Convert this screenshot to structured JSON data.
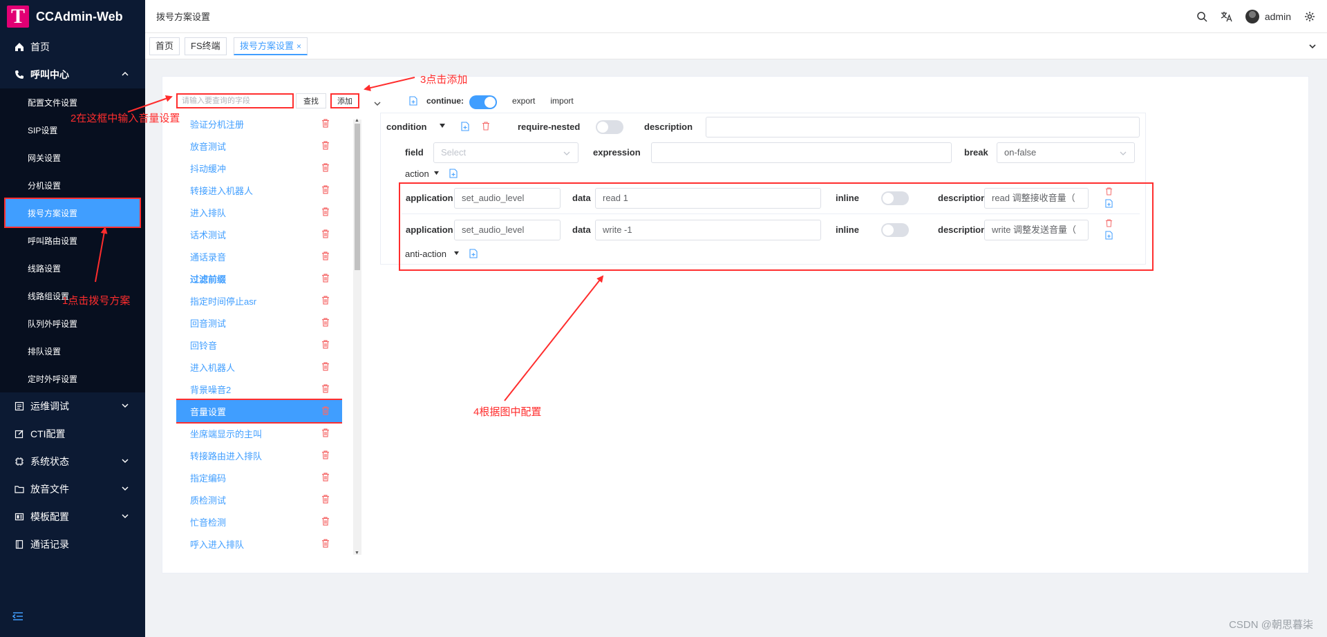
{
  "app": {
    "title": "CCAdmin-Web",
    "logo_letter": "T"
  },
  "sidebar": {
    "items": [
      {
        "label": "首页",
        "icon": "home-icon"
      },
      {
        "label": "呼叫中心",
        "icon": "phone-icon",
        "expanded": true,
        "children": [
          {
            "label": "配置文件设置"
          },
          {
            "label": "SIP设置"
          },
          {
            "label": "网关设置"
          },
          {
            "label": "分机设置"
          },
          {
            "label": "拨号方案设置",
            "active": true
          },
          {
            "label": "呼叫路由设置"
          },
          {
            "label": "线路设置"
          },
          {
            "label": "线路组设置"
          },
          {
            "label": "队列外呼设置"
          },
          {
            "label": "排队设置"
          },
          {
            "label": "定时外呼设置"
          }
        ]
      },
      {
        "label": "运维调试",
        "icon": "debug-icon"
      },
      {
        "label": "CTI配置",
        "icon": "edit-icon"
      },
      {
        "label": "系统状态",
        "icon": "chip-icon"
      },
      {
        "label": "放音文件",
        "icon": "folder-icon"
      },
      {
        "label": "模板配置",
        "icon": "template-icon"
      },
      {
        "label": "通话记录",
        "icon": "notebook-icon"
      }
    ]
  },
  "header": {
    "breadcrumb": "拨号方案设置",
    "username": "admin"
  },
  "tabs": [
    {
      "label": "首页"
    },
    {
      "label": "FS终端"
    },
    {
      "label": "拨号方案设置",
      "active": true,
      "close": "×"
    }
  ],
  "list_panel": {
    "search_placeholder": "请输入要查询的字段",
    "search_button": "查找",
    "add_button": "添加",
    "items": [
      {
        "label": "验证分机注册"
      },
      {
        "label": "放音测试"
      },
      {
        "label": "抖动缓冲"
      },
      {
        "label": "转接进入机器人"
      },
      {
        "label": "进入排队"
      },
      {
        "label": "话术测试"
      },
      {
        "label": "通话录音"
      },
      {
        "label": "过滤前缀",
        "bold": true
      },
      {
        "label": "指定时间停止asr"
      },
      {
        "label": "回音测试"
      },
      {
        "label": "回铃音"
      },
      {
        "label": "进入机器人"
      },
      {
        "label": "背景噪音2"
      },
      {
        "label": "音量设置",
        "selected": true
      },
      {
        "label": "坐席端显示的主叫"
      },
      {
        "label": "转接路由进入排队"
      },
      {
        "label": "指定编码"
      },
      {
        "label": "质检测试"
      },
      {
        "label": "忙音检测"
      },
      {
        "label": "呼入进入排队"
      }
    ]
  },
  "editor": {
    "continue_label": "continue:",
    "continue_on": true,
    "export_label": "export",
    "import_label": "import",
    "condition": {
      "label": "condition",
      "require_nested_label": "require-nested",
      "require_nested_on": false,
      "description_label": "description",
      "description_value": "",
      "field_label": "field",
      "field_placeholder": "Select",
      "expression_label": "expression",
      "expression_value": "",
      "break_label": "break",
      "break_value": "on-false"
    },
    "action_label": "action",
    "actions": [
      {
        "application_label": "application",
        "application": "set_audio_level",
        "data_label": "data",
        "data": "read 1",
        "inline_label": "inline",
        "inline_on": false,
        "description_label": "description",
        "description": "read 调整接收音量（"
      },
      {
        "application_label": "application",
        "application": "set_audio_level",
        "data_label": "data",
        "data": "write -1",
        "inline_label": "inline",
        "inline_on": false,
        "description_label": "description",
        "description": "write 调整发送音量（"
      }
    ],
    "anti_action_label": "anti-action"
  },
  "annotations": {
    "step1": "1点击拨号方案",
    "step2": "2在这框中输入音量设置",
    "step3": "3点击添加",
    "step4": "4根据图中配置",
    "color": "#ff2d2d"
  },
  "watermark": "CSDN @朝思暮柒"
}
